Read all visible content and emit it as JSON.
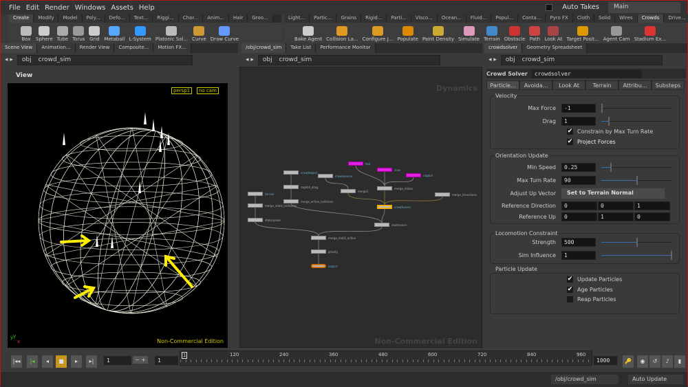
{
  "menu": [
    "File",
    "Edit",
    "Render",
    "Windows",
    "Assets",
    "Help"
  ],
  "auto_takes": "Auto Takes",
  "desktop": "Main",
  "shelf_left_tabs": [
    "Create",
    "Modify",
    "Model",
    "Poly...",
    "Defo...",
    "Text...",
    "Riggi...",
    "Char...",
    "Anim...",
    "Hair",
    "Groo..."
  ],
  "shelf_left_tools": [
    "Box",
    "Sphere",
    "Tube",
    "Torus",
    "Grid",
    "Metaball",
    "L-System",
    "Platonic Sol...",
    "Curve",
    "Draw Curve"
  ],
  "shelf_right_tabs": [
    "Light...",
    "Partic...",
    "Grains",
    "Rigid...",
    "Parti...",
    "Visco...",
    "Ocean...",
    "Fluid...",
    "Popul...",
    "Conta...",
    "Pyro FX",
    "Cloth",
    "Solid",
    "Wires",
    "Crowds",
    "Drive..."
  ],
  "shelf_right_tools": [
    "Bake Agent",
    "Collision La...",
    "Configure J...",
    "Populate",
    "Paint Density",
    "Simulate",
    "Terrain",
    "Obstacle",
    "Path",
    "Look At",
    "Target Posit...",
    "Agent Cam",
    "Stadium Ex..."
  ],
  "left_pane_tabs": [
    "Scene View",
    "Animation...",
    "Render View",
    "Composite...",
    "Motion FX..."
  ],
  "mid_pane_tabs": [
    "/obj/crowd_sim",
    "Take List",
    "Performance Monitor"
  ],
  "right_pane_tabs": [
    "crowdsolver",
    "Geometry Spreadsheet"
  ],
  "path": {
    "root": "obj",
    "node": "crowd_sim"
  },
  "viewport": {
    "title": "View",
    "camera": "persp1",
    "cam": "no cam",
    "watermark": "Non-Commercial Edition",
    "axis_y": "y",
    "axis_x": "x"
  },
  "network": {
    "context": "Dynamics",
    "watermark": "Non-Commercial Edition",
    "nodes": [
      "crowdobject",
      "ragdoll_drag",
      "merge_active_collisions",
      "terrain",
      "merge_static_collisions",
      "staticsolver",
      "crowdsource",
      "merge1",
      "fwd",
      "slow",
      "ragdoll",
      "merge_states",
      "merge_transitions",
      "crowdsolver",
      "multisolver",
      "merge_static_active",
      "gravity",
      "output"
    ]
  },
  "params": {
    "node_type": "Crowd Solver",
    "node_name": "crowdsolver",
    "tabs": [
      "Particle...",
      "Avoida...",
      "Look At",
      "Terrain",
      "Attribu...",
      "Substeps"
    ],
    "velocity": {
      "title": "Velocity",
      "max_force_label": "Max Force",
      "max_force": "-1",
      "drag_label": "Drag",
      "drag": "1",
      "constrain": "Constrain by Max Turn Rate",
      "project": "Project Forces"
    },
    "orientation": {
      "title": "Orientation Update",
      "min_speed_label": "Min Speed",
      "min_speed": "0.25",
      "max_turn_label": "Max Turn Rate",
      "max_turn": "90",
      "adjust_label": "Adjust Up Vector",
      "adjust": "Set to Terrain Normal",
      "ref_dir_label": "Reference Direction",
      "ref_dir": [
        "0",
        "0",
        "1"
      ],
      "ref_up_label": "Reference Up",
      "ref_up": [
        "0",
        "1",
        "0"
      ]
    },
    "locomotion": {
      "title": "Locomotion Constraint",
      "strength_label": "Strength",
      "strength": "500",
      "sim_label": "Sim Influence",
      "sim": "1"
    },
    "particle": {
      "title": "Particle Update",
      "update": "Update Particles",
      "age": "Age Particles",
      "reap": "Reap Particles",
      "checked": [
        true,
        true,
        false
      ]
    }
  },
  "timeline": {
    "frame": "1",
    "step": "1",
    "ticks": [
      "1",
      "120",
      "240",
      "360",
      "480",
      "600",
      "720",
      "840",
      "960"
    ],
    "end": "1000"
  },
  "status": {
    "path": "/obj/crowd_sim",
    "update": "Auto Update"
  }
}
